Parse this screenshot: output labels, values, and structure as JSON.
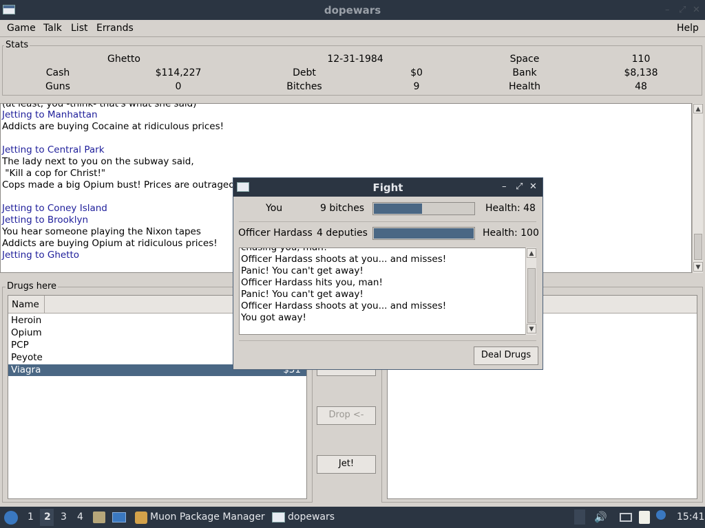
{
  "window": {
    "title": "dopewars"
  },
  "menu": {
    "game": "Game",
    "talk": "Talk",
    "list": "List",
    "errands": "Errands",
    "help": "Help"
  },
  "stats": {
    "group_label": "Stats",
    "location": "Ghetto",
    "date": "12-31-1984",
    "space_label": "Space",
    "space": "110",
    "cash_label": "Cash",
    "cash": "$114,227",
    "debt_label": "Debt",
    "debt": "$0",
    "bank_label": "Bank",
    "bank": "$8,138",
    "guns_label": "Guns",
    "guns": "0",
    "bitches_label": "Bitches",
    "bitches": "9",
    "health_label": "Health",
    "health": "48"
  },
  "log": {
    "lines": [
      "(at least, you -think- that's what she said)",
      "Jetting to Manhattan",
      "Addicts are buying Cocaine at ridiculous prices!",
      "Jetting to Central Park",
      "The lady next to you on the subway said,",
      " \"Kill a cop for Christ!\"",
      "Cops made a big Opium bust! Prices are outrageo",
      "Jetting to Coney Island",
      "Jetting to Brooklyn",
      "You hear someone playing the Nixon tapes",
      "Addicts are buying Opium at ridiculous prices!",
      "Jetting to Ghetto"
    ]
  },
  "drugs": {
    "group_label": "Drugs here",
    "col_name": "Name",
    "items": [
      {
        "name": "Heroin",
        "price": ""
      },
      {
        "name": "Opium",
        "price": ""
      },
      {
        "name": "PCP",
        "price": ""
      },
      {
        "name": "Peyote",
        "price": ""
      },
      {
        "name": "Viagra",
        "price": "$51"
      }
    ],
    "selected": "Viagra"
  },
  "actions": {
    "drop": "Drop <-",
    "jet": "Jet!"
  },
  "fight": {
    "title": "Fight",
    "you_name": "You",
    "you_bitches": "9 bitches",
    "you_health": "Health: 48",
    "you_health_frac": 0.48,
    "enemy_name": "Officer Hardass",
    "enemy_deputies": "4 deputies",
    "enemy_health": "Health: 100",
    "enemy_health_frac": 1.0,
    "log": [
      "chasing you, man!",
      "Officer Hardass shoots at you... and misses!",
      "Panic! You can't get away!",
      "Officer Hardass hits you, man!",
      "Panic! You can't get away!",
      "Officer Hardass shoots at you... and misses!",
      "You got away!"
    ],
    "deal_button": "Deal Drugs"
  },
  "taskbar": {
    "workspaces": [
      "1",
      "2",
      "3",
      "4"
    ],
    "active_workspace": "2",
    "tasks": [
      "Muon Package Manager",
      "dopewars"
    ],
    "clock": "15:41"
  }
}
